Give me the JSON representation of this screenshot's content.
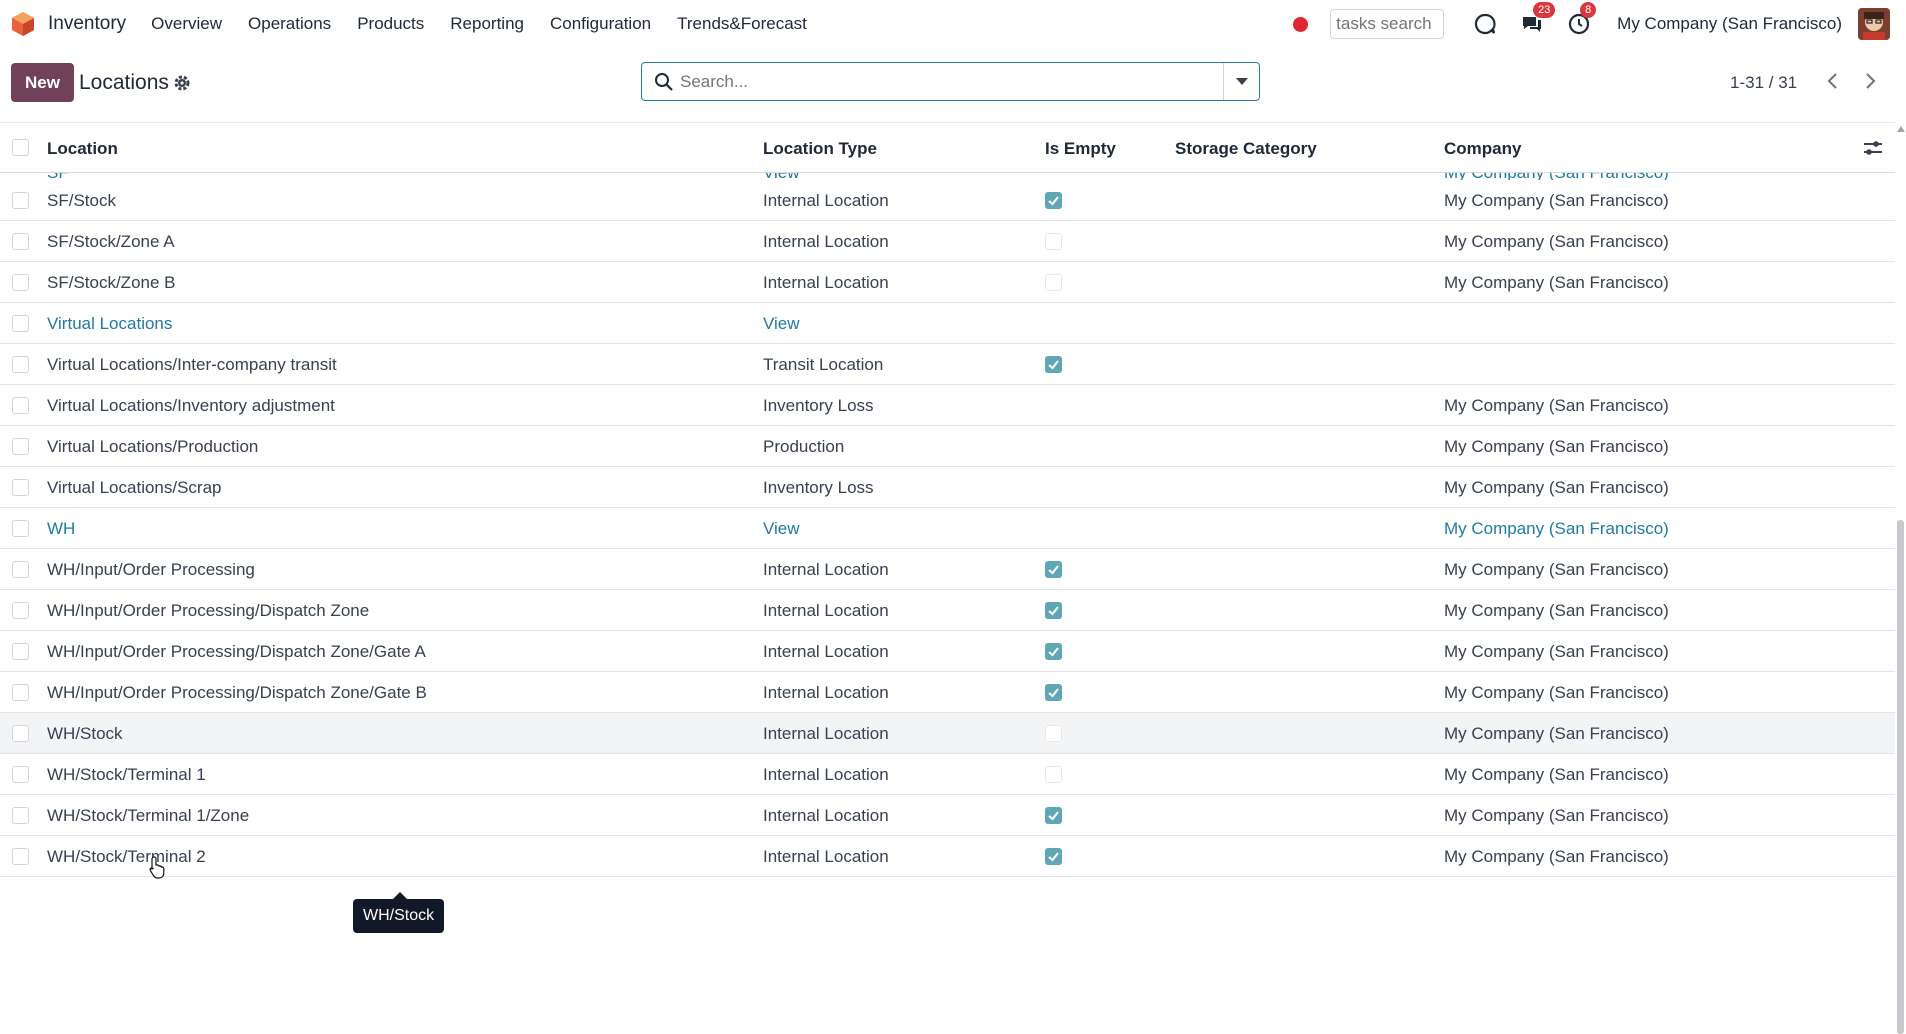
{
  "app": {
    "name": "Inventory",
    "menu": [
      "Overview",
      "Operations",
      "Products",
      "Reporting",
      "Configuration",
      "Trends&Forecast"
    ]
  },
  "topbar": {
    "tasks_search_placeholder": "tasks search",
    "messages_badge": "23",
    "activities_badge": "8",
    "company": "My Company (San Francisco)"
  },
  "control": {
    "new_label": "New",
    "title": "Locations",
    "search_placeholder": "Search...",
    "pager": "1-31 / 31"
  },
  "table": {
    "headers": {
      "location": "Location",
      "type": "Location Type",
      "empty": "Is Empty",
      "storage": "Storage Category",
      "company": "Company"
    },
    "partial_row": {
      "location": "SF",
      "type": "View",
      "company": "My Company (San Francisco)"
    },
    "rows": [
      {
        "location": "SF/Stock",
        "type": "Internal Location",
        "empty": "checked",
        "company": "My Company (San Francisco)",
        "link": false
      },
      {
        "location": "SF/Stock/Zone A",
        "type": "Internal Location",
        "empty": "unchecked",
        "company": "My Company (San Francisco)",
        "link": false
      },
      {
        "location": "SF/Stock/Zone B",
        "type": "Internal Location",
        "empty": "unchecked",
        "company": "My Company (San Francisco)",
        "link": false
      },
      {
        "location": "Virtual Locations",
        "type": "View",
        "empty": "none",
        "company": "",
        "link": true
      },
      {
        "location": "Virtual Locations/Inter-company transit",
        "type": "Transit Location",
        "empty": "checked",
        "company": "",
        "link": false
      },
      {
        "location": "Virtual Locations/Inventory adjustment",
        "type": "Inventory Loss",
        "empty": "none",
        "company": "My Company (San Francisco)",
        "link": false
      },
      {
        "location": "Virtual Locations/Production",
        "type": "Production",
        "empty": "none",
        "company": "My Company (San Francisco)",
        "link": false
      },
      {
        "location": "Virtual Locations/Scrap",
        "type": "Inventory Loss",
        "empty": "none",
        "company": "My Company (San Francisco)",
        "link": false
      },
      {
        "location": "WH",
        "type": "View",
        "empty": "none",
        "company": "My Company (San Francisco)",
        "link": true
      },
      {
        "location": "WH/Input/Order Processing",
        "type": "Internal Location",
        "empty": "checked",
        "company": "My Company (San Francisco)",
        "link": false
      },
      {
        "location": "WH/Input/Order Processing/Dispatch Zone",
        "type": "Internal Location",
        "empty": "checked",
        "company": "My Company (San Francisco)",
        "link": false
      },
      {
        "location": "WH/Input/Order Processing/Dispatch Zone/Gate A",
        "type": "Internal Location",
        "empty": "checked",
        "company": "My Company (San Francisco)",
        "link": false
      },
      {
        "location": "WH/Input/Order Processing/Dispatch Zone/Gate B",
        "type": "Internal Location",
        "empty": "checked",
        "company": "My Company (San Francisco)",
        "link": false
      },
      {
        "location": "WH/Stock",
        "type": "Internal Location",
        "empty": "unchecked",
        "company": "My Company (San Francisco)",
        "link": false,
        "hover": true
      },
      {
        "location": "WH/Stock/Terminal 1",
        "type": "Internal Location",
        "empty": "unchecked",
        "company": "My Company (San Francisco)",
        "link": false
      },
      {
        "location": "WH/Stock/Terminal 1/Zone",
        "type": "Internal Location",
        "empty": "checked",
        "company": "My Company (San Francisco)",
        "link": false
      },
      {
        "location": "WH/Stock/Terminal 2",
        "type": "Internal Location",
        "empty": "checked",
        "company": "My Company (San Francisco)",
        "link": false
      }
    ]
  },
  "tooltip": {
    "text": "WH/Stock"
  },
  "colors": {
    "brand": "#71415a",
    "link": "#1f7aa3",
    "check": "#5fa7b4",
    "badge": "#d9383e"
  }
}
